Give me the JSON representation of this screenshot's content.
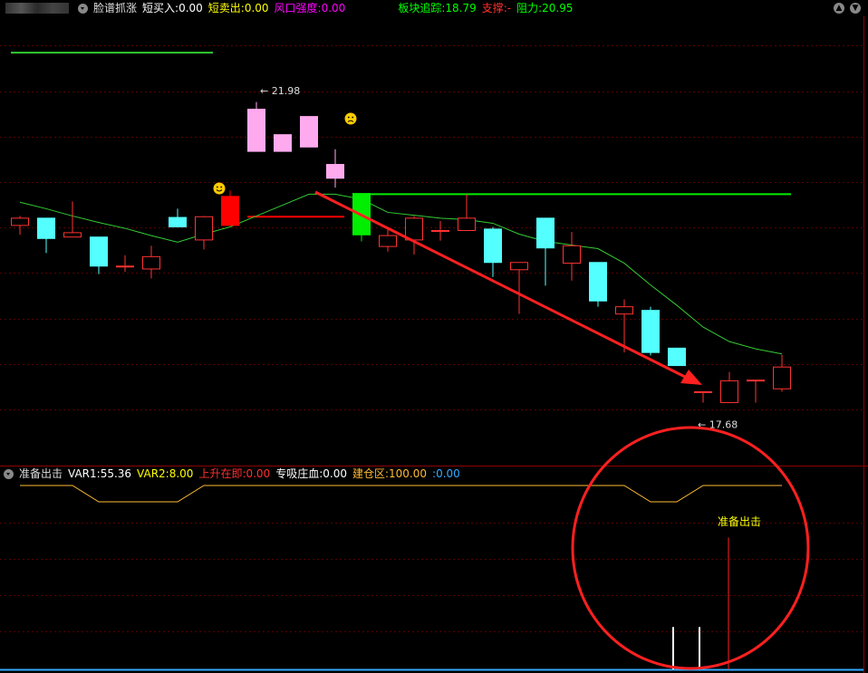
{
  "header": {
    "title": "脸谱抓涨",
    "metrics": [
      {
        "label": "短买入:",
        "value": "0.00",
        "color": "#ffffff"
      },
      {
        "label": "短卖出:",
        "value": "0.00",
        "color": "#ffff00"
      },
      {
        "label": "风口强度:",
        "value": "0.00",
        "color": "#ff00ff"
      },
      {
        "label": "板块追踪:",
        "value": "18.79",
        "color": "#00ff00"
      },
      {
        "label": "支撑:",
        "value": "-",
        "color": "#ff3030"
      },
      {
        "label": "阻力:",
        "value": "20.95",
        "color": "#00ff00"
      }
    ]
  },
  "indicator": {
    "title": "准备出击",
    "metrics": [
      {
        "label": "VAR1:",
        "value": "55.36",
        "color": "#ffffff"
      },
      {
        "label": "VAR2:",
        "value": "8.00",
        "color": "#ffff00"
      },
      {
        "label": "上升在即:",
        "value": "0.00",
        "color": "#ff3030"
      },
      {
        "label": "专吸庄血:",
        "value": "0.00",
        "color": "#ffffff"
      },
      {
        "label": "建仓区:",
        "value": "100.00",
        "color": "#ffbb33"
      },
      {
        "label": ":",
        "value": "0.00",
        "color": "#33aaff"
      }
    ],
    "signal_label": "准备出击"
  },
  "colors": {
    "up": "#ff3232",
    "down": "#54ffff",
    "ma": "#33cc33",
    "signal_buy": "#ff0000",
    "signal_sell": "#00ee00",
    "pink": "#ffaaee",
    "yellow_line": "#ffbb33",
    "cyan_line": "#33aaff"
  },
  "chart_data": {
    "type": "candlestick",
    "price_range": [
      16.9,
      23.0
    ],
    "high_label": "21.98",
    "low_label": "17.68",
    "candles": [
      {
        "o": 20.12,
        "h": 20.25,
        "l": 19.99,
        "c": 20.22
      },
      {
        "o": 20.22,
        "h": 20.22,
        "l": 19.74,
        "c": 19.94
      },
      {
        "o": 19.96,
        "h": 20.45,
        "l": 19.96,
        "c": 20.02
      },
      {
        "o": 19.96,
        "h": 19.96,
        "l": 19.45,
        "c": 19.56
      },
      {
        "o": 19.56,
        "h": 19.71,
        "l": 19.48,
        "c": 19.56
      },
      {
        "o": 19.52,
        "h": 19.84,
        "l": 19.39,
        "c": 19.69
      },
      {
        "o": 20.23,
        "h": 20.35,
        "l": 20.1,
        "c": 20.1
      },
      {
        "o": 19.92,
        "h": 20.25,
        "l": 19.79,
        "c": 20.24
      },
      {
        "o": 20.12,
        "h": 20.6,
        "l": 20.12,
        "c": 20.52,
        "fill": "signal_buy"
      },
      {
        "o": 21.14,
        "h": 21.82,
        "l": 21.14,
        "c": 21.72,
        "fill": "pink"
      },
      {
        "o": 21.14,
        "h": 21.32,
        "l": 21.14,
        "c": 21.37,
        "fill": "pink"
      },
      {
        "o": 21.2,
        "h": 21.56,
        "l": 21.2,
        "c": 21.62,
        "fill": "pink"
      },
      {
        "o": 20.77,
        "h": 21.17,
        "l": 20.64,
        "c": 20.96,
        "fill": "pink"
      },
      {
        "o": 20.56,
        "h": 20.56,
        "l": 19.9,
        "c": 19.99,
        "fill": "signal_sell"
      },
      {
        "o": 19.83,
        "h": 20.1,
        "l": 19.76,
        "c": 19.98
      },
      {
        "o": 19.92,
        "h": 20.25,
        "l": 19.72,
        "c": 20.22
      },
      {
        "o": 20.05,
        "h": 20.18,
        "l": 19.91,
        "c": 20.05
      },
      {
        "o": 20.05,
        "h": 20.55,
        "l": 20.05,
        "c": 20.22
      },
      {
        "o": 20.07,
        "h": 20.1,
        "l": 19.41,
        "c": 19.61
      },
      {
        "o": 19.51,
        "h": 19.61,
        "l": 18.9,
        "c": 19.61
      },
      {
        "o": 20.22,
        "h": 20.22,
        "l": 19.29,
        "c": 19.81
      },
      {
        "o": 19.6,
        "h": 20.03,
        "l": 19.36,
        "c": 19.84
      },
      {
        "o": 19.61,
        "h": 19.59,
        "l": 19.0,
        "c": 19.08
      },
      {
        "o": 18.9,
        "h": 19.1,
        "l": 18.37,
        "c": 19.0
      },
      {
        "o": 18.95,
        "h": 19.0,
        "l": 18.33,
        "c": 18.37
      },
      {
        "o": 18.43,
        "h": 18.43,
        "l": 18.19,
        "c": 18.19
      },
      {
        "o": 17.83,
        "h": 17.83,
        "l": 17.68,
        "c": 17.83
      },
      {
        "o": 17.68,
        "h": 18.1,
        "l": 17.68,
        "c": 17.98
      },
      {
        "o": 17.99,
        "h": 17.99,
        "l": 17.68,
        "c": 17.99
      },
      {
        "o": 17.87,
        "h": 18.34,
        "l": 17.83,
        "c": 18.17
      }
    ],
    "ma": [
      20.44,
      20.35,
      20.25,
      20.16,
      20.08,
      19.98,
      19.89,
      20.0,
      20.1,
      20.25,
      20.4,
      20.55,
      20.55,
      20.48,
      20.3,
      20.26,
      20.22,
      20.2,
      20.15,
      20.0,
      19.9,
      19.85,
      19.8,
      19.6,
      19.3,
      19.02,
      18.72,
      18.52,
      18.42,
      18.35
    ],
    "support_levels": [
      {
        "value": 22.5,
        "from": 0,
        "to": 7,
        "color": "ma"
      },
      {
        "value": 20.55,
        "from": 13,
        "to": 29,
        "color": "signal_sell"
      },
      {
        "value": 20.24,
        "from": 9,
        "to": 12,
        "color": "signal_buy"
      }
    ],
    "indicator": {
      "range": [
        0,
        100
      ],
      "jianchang": [
        100,
        100,
        100,
        55,
        55,
        55,
        55,
        100,
        100,
        100,
        100,
        100,
        100,
        100,
        100,
        100,
        100,
        100,
        100,
        100,
        100,
        100,
        100,
        100,
        55,
        55,
        100,
        100,
        100,
        100
      ],
      "cyan_line": 0,
      "white_bars": [
        {
          "index": 25,
          "value": 25
        },
        {
          "index": 26,
          "value": 25
        }
      ],
      "red_signal": {
        "index": 27,
        "value": 80
      }
    }
  }
}
